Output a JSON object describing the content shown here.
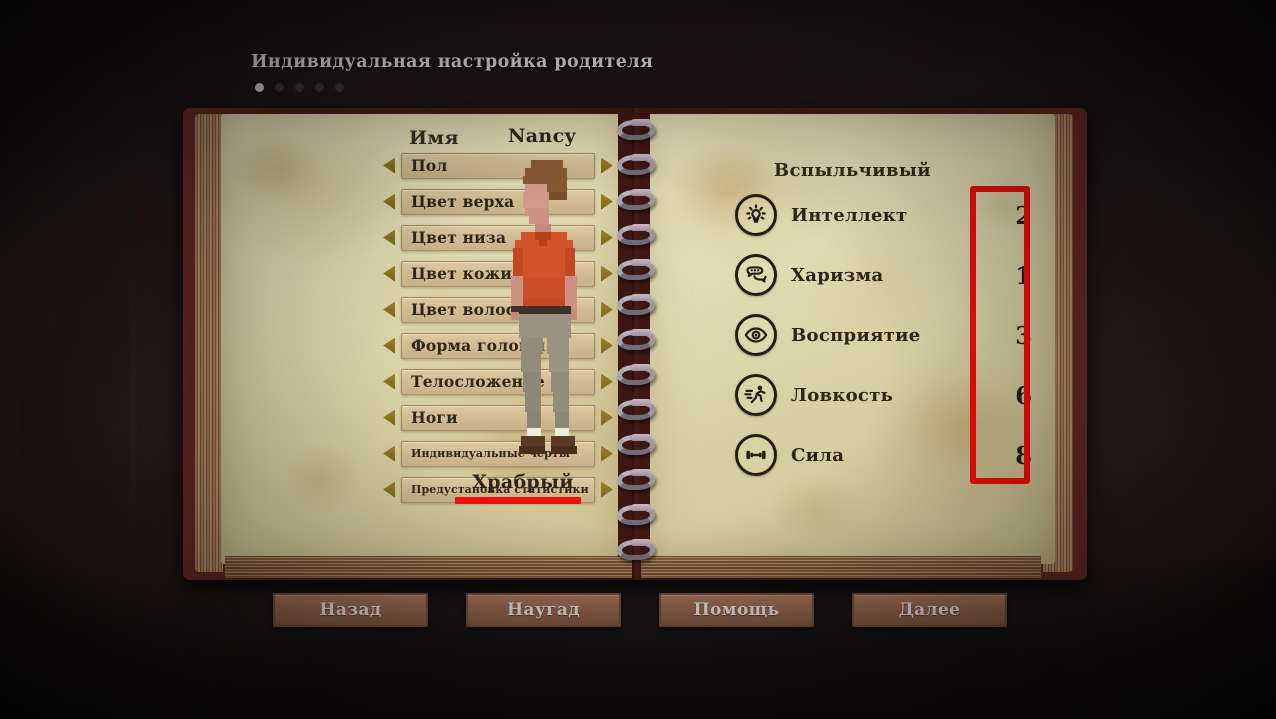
{
  "header": {
    "title": "Индивидуальная настройка родителя",
    "dots_total": 5,
    "dot_active_index": 0
  },
  "left_page": {
    "name_label": "Имя",
    "options": [
      {
        "label": "Пол",
        "size": "normal"
      },
      {
        "label": "Цвет верха",
        "size": "normal"
      },
      {
        "label": "Цвет низа",
        "size": "normal"
      },
      {
        "label": "Цвет кожи",
        "size": "normal"
      },
      {
        "label": "Цвет волос",
        "size": "normal"
      },
      {
        "label": "Форма головы",
        "size": "normal"
      },
      {
        "label": "Телосложение",
        "size": "normal"
      },
      {
        "label": "Ноги",
        "size": "normal"
      },
      {
        "label": "Индивидуальные черты",
        "size": "small"
      },
      {
        "label": "Предустановка статистики",
        "size": "small"
      }
    ]
  },
  "character": {
    "name": "Nancy",
    "trait": "Храбрый",
    "colors": {
      "hair": "#8a5a33",
      "skin": "#d49b8c",
      "shirt": "#d4532b",
      "pants": "#9b9382",
      "shoes": "#5a3a22",
      "socks": "#efeade",
      "belt": "#3e3024"
    }
  },
  "right_page": {
    "temperament": "Вспыльчивый",
    "stats": [
      {
        "icon": "lightbulb-icon",
        "label": "Интеллект",
        "value": "2"
      },
      {
        "icon": "speech-bubble-icon",
        "label": "Харизма",
        "value": "1"
      },
      {
        "icon": "eye-icon",
        "label": "Восприятие",
        "value": "3"
      },
      {
        "icon": "running-icon",
        "label": "Ловкость",
        "value": "6"
      },
      {
        "icon": "dumbbell-icon",
        "label": "Сила",
        "value": "8"
      }
    ]
  },
  "annotations": {
    "highlight_color": "#f20d0d",
    "underline_color": "#ef1010"
  },
  "footer": {
    "buttons": [
      {
        "label": "Назад"
      },
      {
        "label": "Наугад"
      },
      {
        "label": "Помощь"
      },
      {
        "label": "Далее"
      }
    ]
  }
}
